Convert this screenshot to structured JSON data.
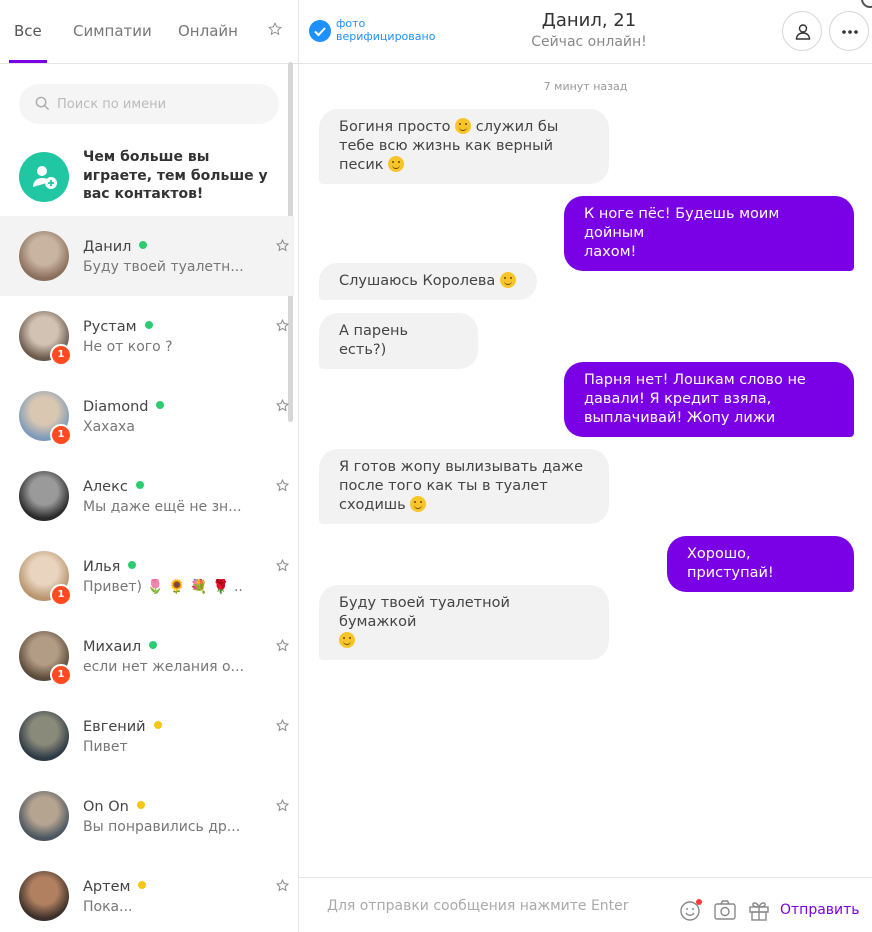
{
  "tabs": [
    {
      "label": "Все",
      "active": true
    },
    {
      "label": "Симпатии",
      "active": false
    },
    {
      "label": "Онлайн",
      "active": false
    }
  ],
  "search": {
    "placeholder": "Поиск по имени"
  },
  "promo": {
    "text": "Чем больше вы играете, тем больше у вас контактов!"
  },
  "contacts": [
    {
      "name": "Данил",
      "status": "green",
      "last_message": "Буду твоей туалетн...",
      "unread": null,
      "active": true
    },
    {
      "name": "Рустам",
      "status": "green",
      "last_message": "Не от кого ?",
      "unread": "1"
    },
    {
      "name": "Diamond",
      "status": "green",
      "last_message": "Хахаха",
      "unread": "1"
    },
    {
      "name": "Алекс",
      "status": "green",
      "last_message": "Мы даже ещё не зн...",
      "unread": null
    },
    {
      "name": "Илья",
      "status": "green",
      "last_message": "Привет) 🌷 🌻 💐 🌹 ...",
      "unread": "1"
    },
    {
      "name": "Михаил",
      "status": "green",
      "last_message": "если нет желания о...",
      "unread": "1"
    },
    {
      "name": "Евгений",
      "status": "yellow",
      "last_message": "Пивет",
      "unread": null
    },
    {
      "name": "On On",
      "status": "yellow",
      "last_message": "Вы понравились др...",
      "unread": null
    },
    {
      "name": "Артем",
      "status": "yellow",
      "last_message": "Пока...",
      "unread": null
    }
  ],
  "header": {
    "verified_label": "фото верифицировано",
    "name": "Данил, 21",
    "status": "Сейчас онлайн!"
  },
  "chat": {
    "timestamp": "7 минут назад",
    "messages": [
      {
        "direction": "in",
        "lines": [
          "Богиня просто :emoji: служил бы",
          "тебе всю жизнь как верный",
          "песик :emoji:"
        ]
      },
      {
        "direction": "out",
        "lines": [
          "К ноге пёс! Будешь моим дойным",
          "лахом!"
        ]
      },
      {
        "direction": "in",
        "lines": [
          "Слушаюсь Королева :emoji:"
        ]
      },
      {
        "direction": "in",
        "lines": [
          "А парень есть?)"
        ]
      },
      {
        "direction": "out",
        "lines": [
          "Парня нет! Лошкам слово не",
          "давали! Я кредит взяла,",
          "выплачивай! Жопу лижи"
        ]
      },
      {
        "direction": "in",
        "lines": [
          "Я готов жопу вылизывать даже",
          "после того как ты в туалет",
          "сходишь :emoji:"
        ]
      },
      {
        "direction": "out",
        "lines": [
          "Хорошо, приступай!"
        ]
      },
      {
        "direction": "in",
        "lines": [
          "Буду твоей туалетной бумажкой",
          ":emoji:"
        ]
      }
    ]
  },
  "composer": {
    "placeholder": "Для отправки сообщения нажмите Enter",
    "send_label": "Отправить"
  },
  "icons": [
    "star-icon",
    "search-icon",
    "add-contact-icon",
    "check-icon",
    "profile-icon",
    "more-icon",
    "emoji-icon",
    "camera-icon",
    "gift-icon"
  ],
  "colors": {
    "accent": "#7a00e6",
    "online": "#2ecc71",
    "away": "#f5c518",
    "badge": "#ff4b1f",
    "promo": "#21c7a3",
    "verified": "#1e90ff"
  }
}
